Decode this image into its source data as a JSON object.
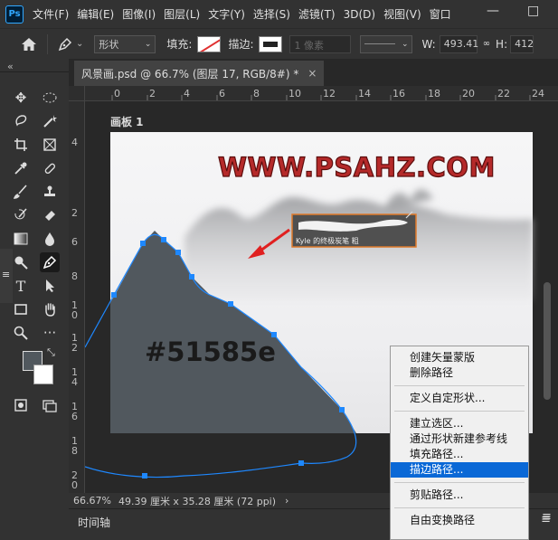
{
  "app": {
    "logo": "Ps"
  },
  "menubar": {
    "items": [
      "文件(F)",
      "编辑(E)",
      "图像(I)",
      "图层(L)",
      "文字(Y)",
      "选择(S)",
      "滤镜(T)",
      "3D(D)",
      "视图(V)",
      "窗口"
    ],
    "controls": {
      "minimize": "—",
      "restore": "□"
    }
  },
  "options": {
    "mode_value": "形状",
    "fill_label": "填充:",
    "stroke_label": "描边:",
    "stroke_width_placeholder": "1 像素",
    "w_label": "W:",
    "w_value": "493.41",
    "h_label": "H:",
    "h_value": "412",
    "stroke_color": "#e03030"
  },
  "toolbar": {
    "collapse_glyph": "«",
    "foreground_color": "#51585e",
    "background_color": "#ffffff"
  },
  "document": {
    "tab_title": "风景画.psd @ 66.7% (图层 17, RGB/8#) *",
    "close_glyph": "×"
  },
  "rulers": {
    "horizontal": [
      "0",
      "2",
      "4",
      "6",
      "8",
      "10",
      "12",
      "14",
      "16",
      "18",
      "20",
      "22",
      "24"
    ],
    "vertical": [
      "2",
      "4",
      "6",
      "8",
      "1\n0",
      "1\n2",
      "1\n4",
      "1\n6",
      "1\n8",
      "2\n0",
      "2"
    ]
  },
  "canvas": {
    "artboard_label": "画板 1",
    "watermark": "WWW.PSAHZ.COM",
    "color_code": "#51585e",
    "mountain_color": "#51585e",
    "brush_preview_caption": "Kyle 的终极炭笔 粗",
    "path_color": "#1e88ff",
    "arrow_color": "#e02020"
  },
  "status": {
    "zoom": "66.67%",
    "doc_size": "49.39 厘米 x 35.28 厘米 (72 ppi)",
    "arrow": "›"
  },
  "timeline": {
    "label": "时间轴"
  },
  "context_menu": {
    "groups": [
      [
        "创建矢量蒙版",
        "删除路径"
      ],
      [
        "定义自定形状..."
      ],
      [
        "建立选区...",
        "通过形状新建参考线",
        "填充路径...",
        "描边路径..."
      ],
      [
        "剪贴路径..."
      ],
      [
        "自由变换路径"
      ]
    ],
    "highlighted": "描边路径..."
  }
}
